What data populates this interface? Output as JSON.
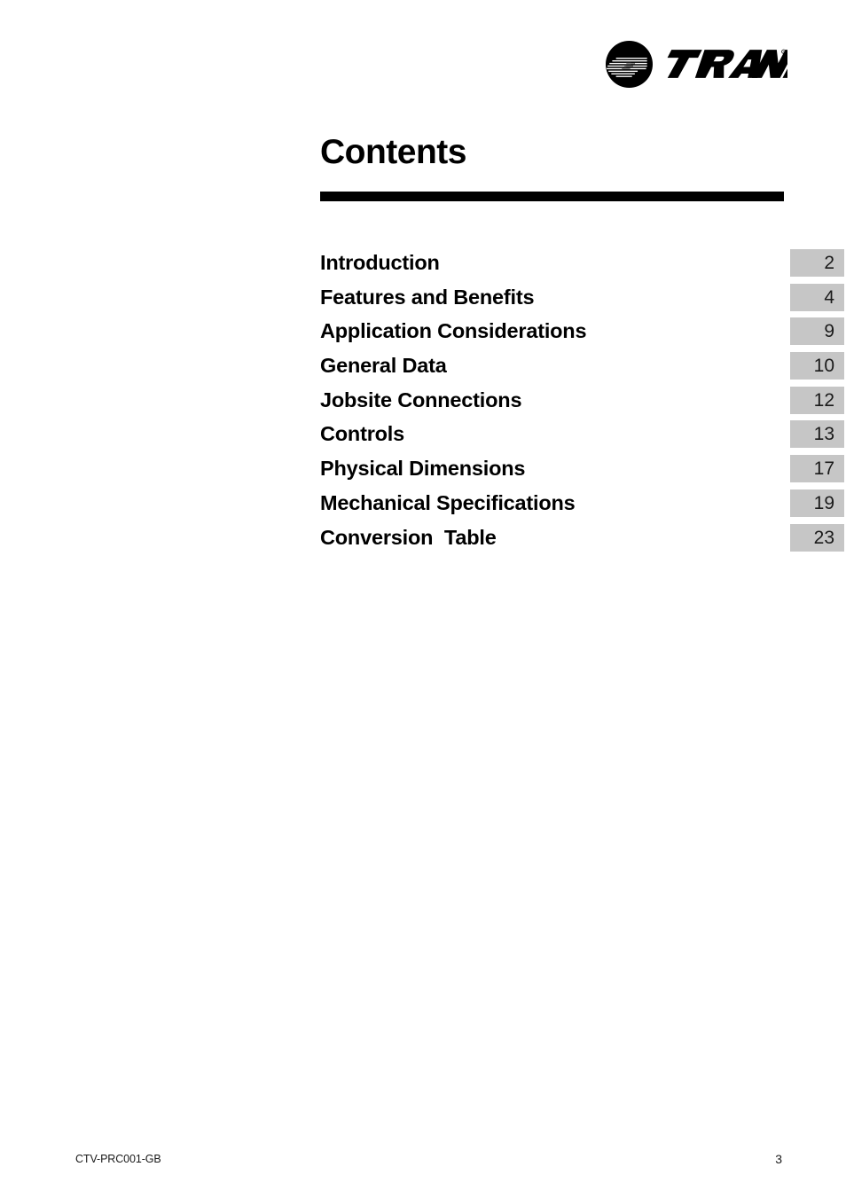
{
  "document": {
    "title": "Contents"
  },
  "brand": {
    "mark_icon": "trane-circle-logo-icon",
    "wordmark": "TRANE",
    "registered_mark": "®"
  },
  "toc": {
    "entries": [
      {
        "label": "Introduction",
        "page": "2"
      },
      {
        "label": "Features and Benefits",
        "page": "4"
      },
      {
        "label": "Application Considerations",
        "page": "9"
      },
      {
        "label": "General Data",
        "page": "10"
      },
      {
        "label": "Jobsite Connections",
        "page": "12"
      },
      {
        "label": "Controls",
        "page": "13"
      },
      {
        "label": "Physical Dimensions",
        "page": "17"
      },
      {
        "label": "Mechanical Specifications",
        "page": "19"
      },
      {
        "label": "Conversion  Table",
        "page": "23"
      }
    ]
  },
  "footer": {
    "document_code": "CTV-PRC001-GB",
    "page_number": "3"
  },
  "colors": {
    "page_box_gray": "#c6c6c6",
    "rule_black": "#000000",
    "text_black": "#000000"
  }
}
